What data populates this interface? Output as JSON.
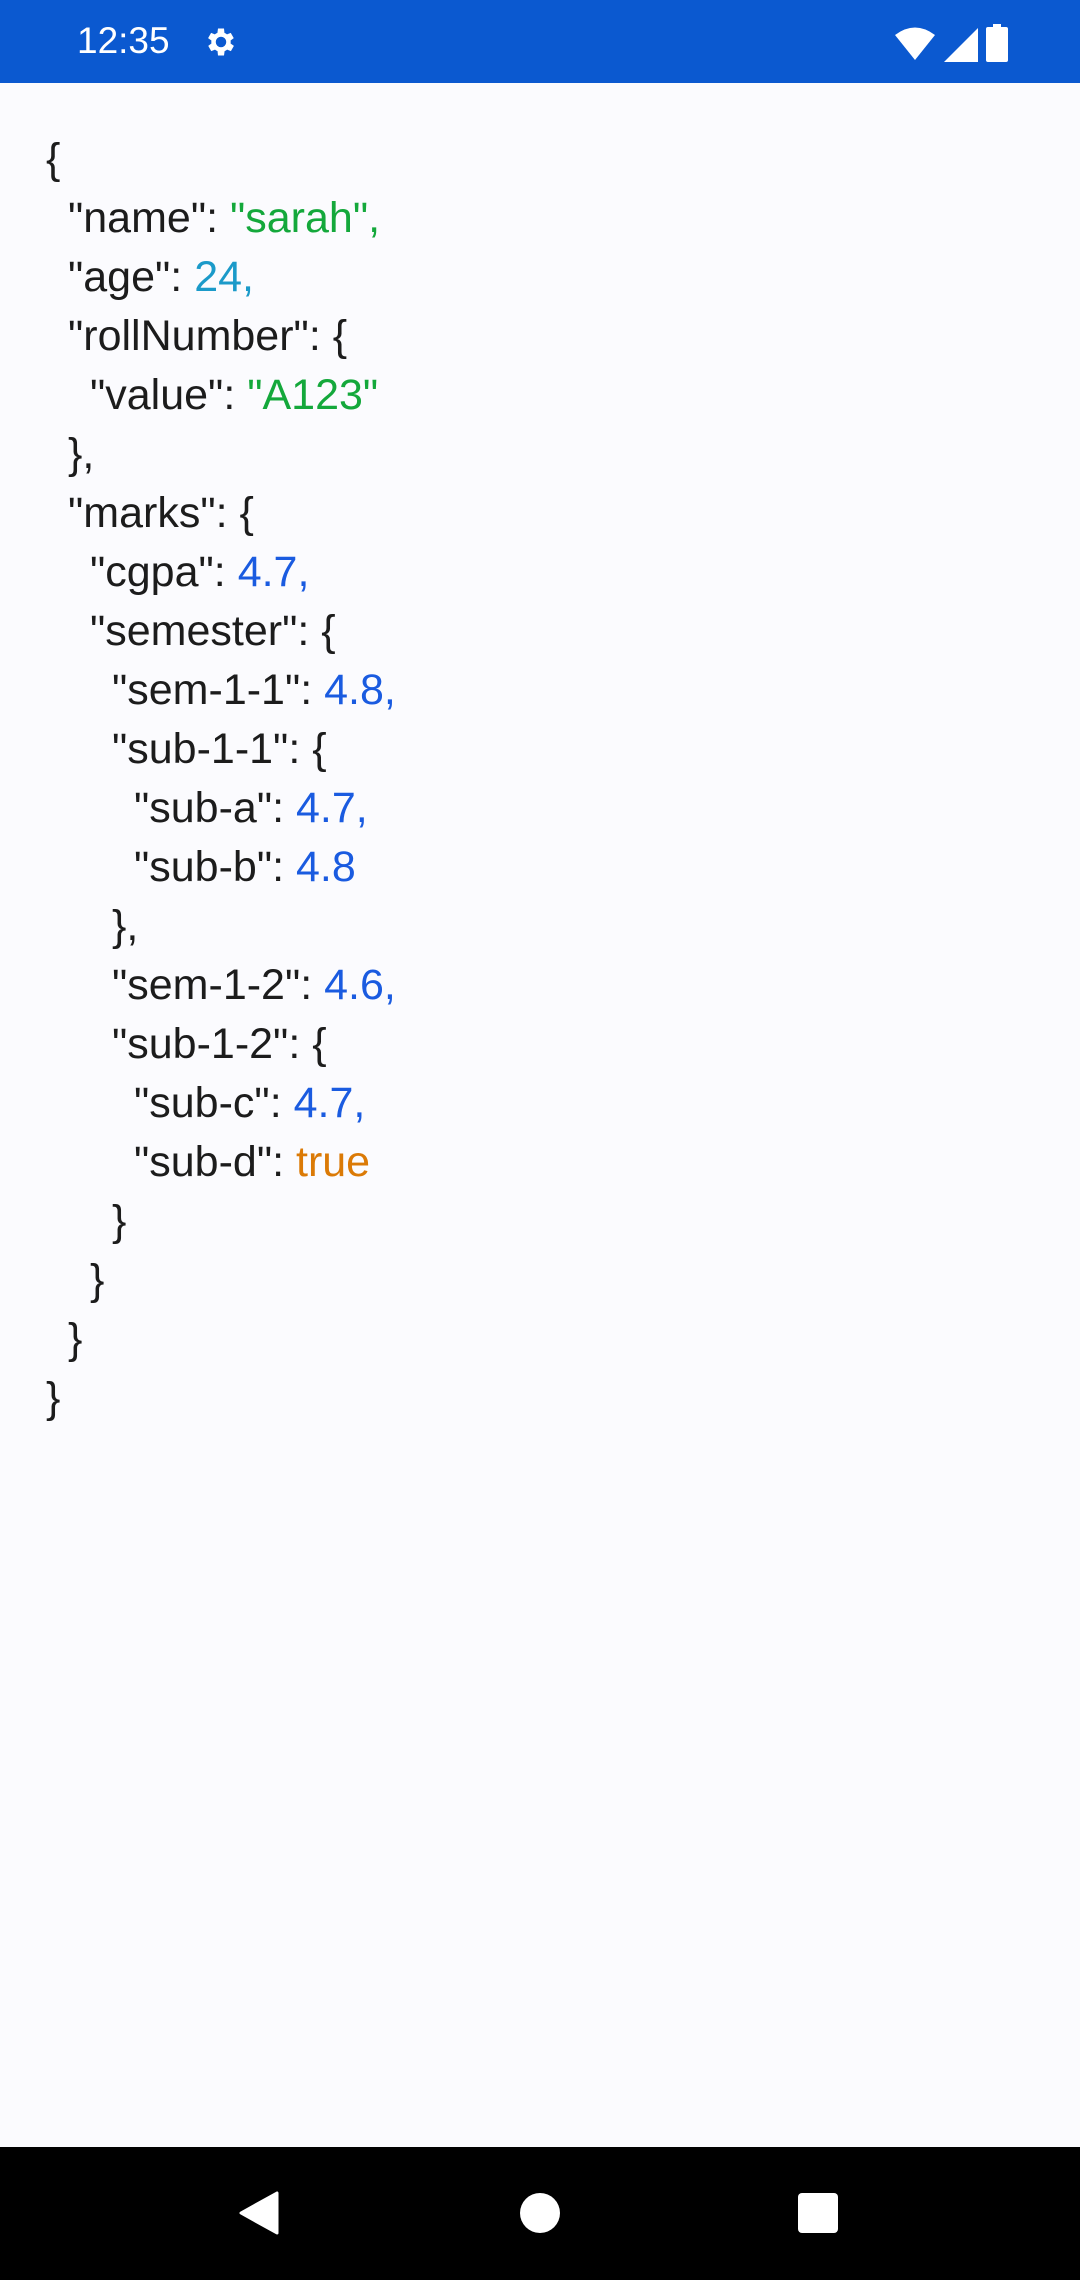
{
  "status_bar": {
    "time": "12:35",
    "icons": [
      "settings-icon",
      "wifi-icon",
      "signal-icon",
      "battery-icon"
    ]
  },
  "colors": {
    "string": "#14a83b",
    "integer": "#1b9ac9",
    "float": "#1a5be0",
    "boolean": "#db7a06",
    "status_bar": "#0b59d0"
  },
  "json_lines": [
    {
      "open": "{"
    },
    {
      "key": "\"name\"",
      "value": "\"sarah\"",
      "type": "string",
      "comma": true
    },
    {
      "key": "\"age\"",
      "value": "24",
      "type": "integer",
      "comma": true
    },
    {
      "key": "\"rollNumber\"",
      "open": "{"
    },
    {
      "key": "\"value\"",
      "value": "\"A123\"",
      "type": "string"
    },
    {
      "close": "}",
      "comma": true
    },
    {
      "key": "\"marks\"",
      "open": "{"
    },
    {
      "key": "\"cgpa\"",
      "value": "4.7",
      "type": "float",
      "comma": true
    },
    {
      "key": "\"semester\"",
      "open": "{"
    },
    {
      "key": "\"sem-1-1\"",
      "value": "4.8",
      "type": "float",
      "comma": true
    },
    {
      "key": "\"sub-1-1\"",
      "open": "{"
    },
    {
      "key": "\"sub-a\"",
      "value": "4.7",
      "type": "float",
      "comma": true
    },
    {
      "key": "\"sub-b\"",
      "value": "4.8",
      "type": "float"
    },
    {
      "close": "}",
      "comma": true
    },
    {
      "key": "\"sem-1-2\"",
      "value": "4.6",
      "type": "float",
      "comma": true
    },
    {
      "key": "\"sub-1-2\"",
      "open": "{"
    },
    {
      "key": "\"sub-c\"",
      "value": "4.7",
      "type": "float",
      "comma": true
    },
    {
      "key": "\"sub-d\"",
      "value": "true",
      "type": "boolean"
    },
    {
      "close": "}"
    },
    {
      "close": "}"
    },
    {
      "close": "}"
    },
    {
      "close": "}"
    }
  ],
  "nav_bar": {
    "buttons": [
      "back",
      "home",
      "recents"
    ]
  }
}
